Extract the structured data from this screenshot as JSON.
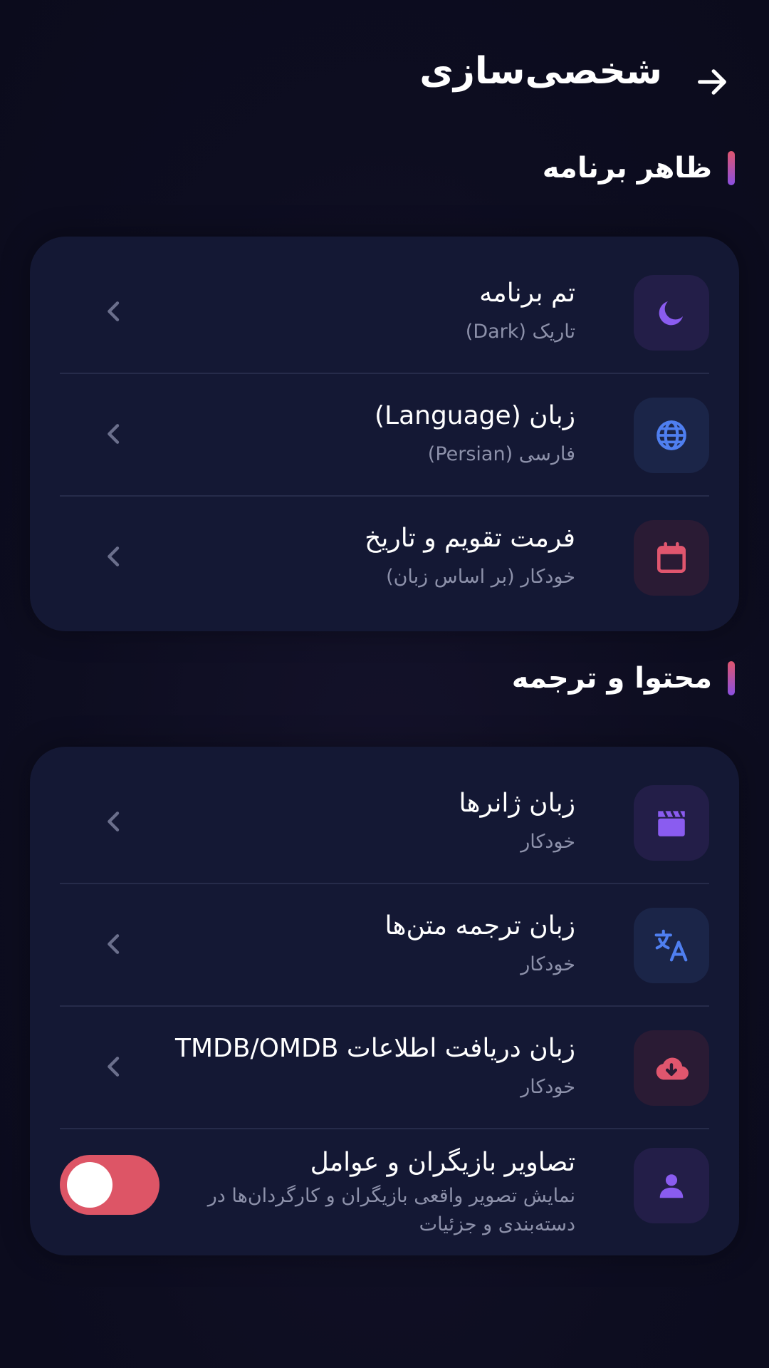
{
  "header": {
    "title": "شخصی‌سازی",
    "back_icon": "arrow-right-icon"
  },
  "colors": {
    "accent_gradient_top": "#e0566e",
    "accent_gradient_bottom": "#8a4fe0",
    "toggle_on": "#dd5566",
    "card_bg": "#141834"
  },
  "appearance": {
    "title": "ظاهر برنامه",
    "items": [
      {
        "title": "تم برنامه",
        "subtitle": "تاریک (Dark)",
        "icon": "moon-icon"
      },
      {
        "title": "زبان (Language)",
        "subtitle": "فارسی (Persian)",
        "icon": "globe-icon"
      },
      {
        "title": "فرمت تقویم و تاریخ",
        "subtitle": "خودکار (بر اساس زبان)",
        "icon": "calendar-icon"
      }
    ]
  },
  "content": {
    "title": "محتوا و ترجمه",
    "items": [
      {
        "title": "زبان ژانرها",
        "subtitle": "خودکار",
        "icon": "clapperboard-icon"
      },
      {
        "title": "زبان ترجمه متن‌ها",
        "subtitle": "خودکار",
        "icon": "translate-icon"
      },
      {
        "title": "زبان دریافت اطلاعات TMDB/OMDB",
        "subtitle": "خودکار",
        "icon": "cloud-download-icon"
      }
    ],
    "toggle_item": {
      "title": "تصاویر بازیگران و عوامل",
      "subtitle": "نمایش تصویر واقعی بازیگران و کارگردان‌ها در دسته‌بندی و جزئیات",
      "icon": "person-icon",
      "enabled": true
    }
  }
}
